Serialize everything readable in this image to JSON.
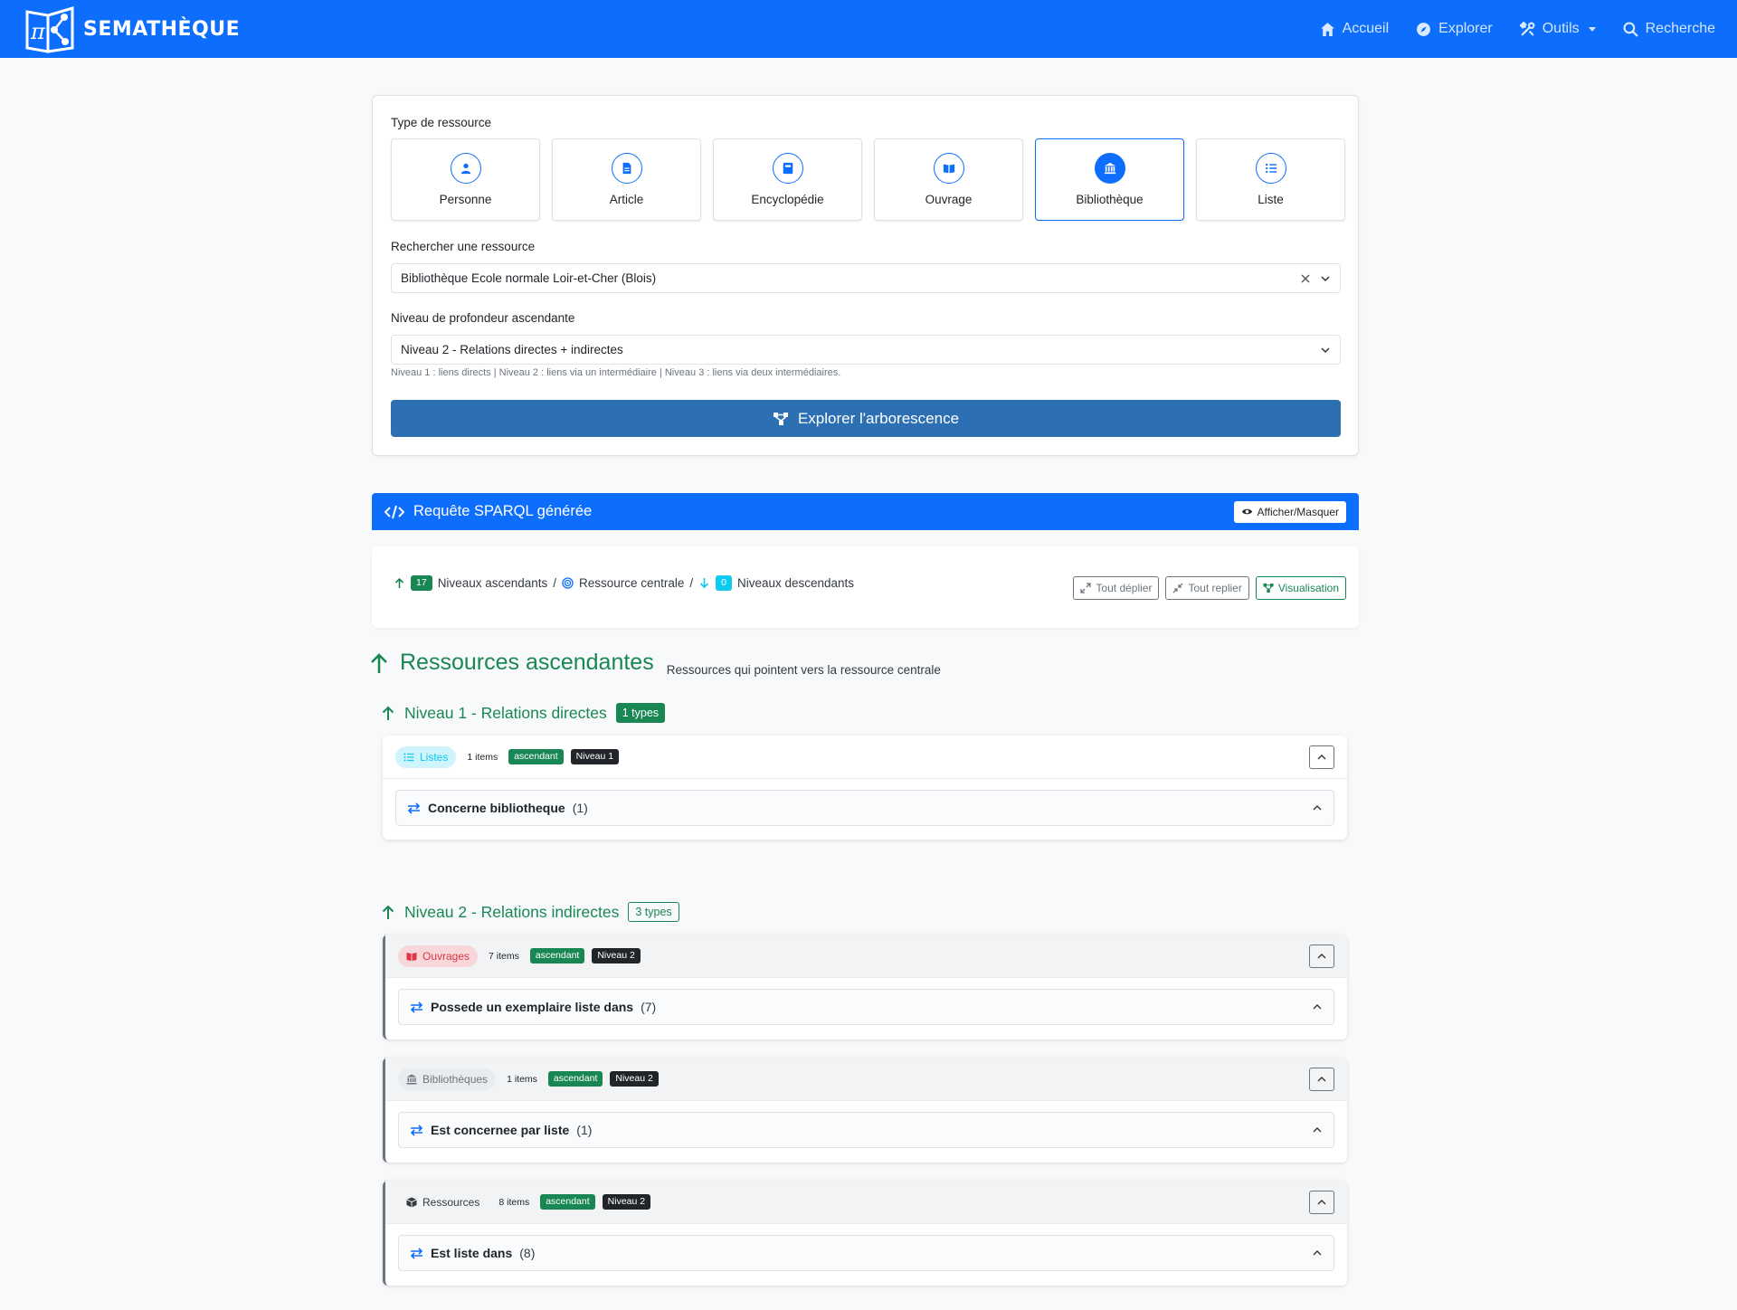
{
  "app": {
    "brand": "SEMATHÈQUE"
  },
  "nav": {
    "accueil": "Accueil",
    "explorer": "Explorer",
    "outils": "Outils",
    "recherche": "Recherche"
  },
  "form": {
    "type_label": "Type de ressource",
    "types": [
      {
        "label": "Personne",
        "icon": "person-icon",
        "active": false
      },
      {
        "label": "Article",
        "icon": "file-icon",
        "active": false
      },
      {
        "label": "Encyclopédie",
        "icon": "book-icon",
        "active": false
      },
      {
        "label": "Ouvrage",
        "icon": "open-book-icon",
        "active": false
      },
      {
        "label": "Bibliothèque",
        "icon": "library-icon",
        "active": true
      },
      {
        "label": "Liste",
        "icon": "list-icon",
        "active": false
      }
    ],
    "search_label": "Rechercher une ressource",
    "search_value": "Bibliothèque Ecole normale Loir-et-Cher (Blois)",
    "depth_label": "Niveau de profondeur ascendante",
    "depth_value": "Niveau 2 - Relations directes + indirectes",
    "depth_help": "Niveau 1 : liens directs | Niveau 2 : liens via un intermédiaire | Niveau 3 : liens via deux intermédiaires.",
    "explore_button": "Explorer l'arborescence"
  },
  "sparql": {
    "title": "Requête SPARQL générée",
    "toggle": "Afficher/Masquer"
  },
  "breadcrumb": {
    "asc_count": "17",
    "asc_label": "Niveaux ascendants",
    "sep": "/",
    "central_label": "Ressource centrale",
    "desc_count": "0",
    "desc_label": "Niveaux descendants",
    "expand_all": "Tout déplier",
    "collapse_all": "Tout replier",
    "visualisation": "Visualisation"
  },
  "ascendants": {
    "title": "Ressources ascendantes",
    "subtitle": "Ressources qui pointent vers la ressource centrale",
    "level1": {
      "title": "Niveau 1 - Relations directes",
      "badge": "1 types",
      "groups": [
        {
          "pill": "Listes",
          "items": "1 items",
          "dir": "ascendant",
          "level": "Niveau 1",
          "relation": "Concerne bibliotheque",
          "count": "(1)"
        }
      ]
    },
    "level2": {
      "title": "Niveau 2 - Relations indirectes",
      "badge": "3 types",
      "groups": [
        {
          "pill": "Ouvrages",
          "items": "7 items",
          "dir": "ascendant",
          "level": "Niveau 2",
          "relation": "Possede un exemplaire liste dans",
          "count": "(7)"
        },
        {
          "pill": "Bibliothèques",
          "items": "1 items",
          "dir": "ascendant",
          "level": "Niveau 2",
          "relation": "Est concernee par liste",
          "count": "(1)"
        },
        {
          "pill": "Ressources",
          "items": "8 items",
          "dir": "ascendant",
          "level": "Niveau 2",
          "relation": "Est liste dans",
          "count": "(8)"
        }
      ]
    }
  },
  "colors": {
    "primary": "#0d6efd",
    "success": "#198754",
    "button": "#2c6fb3"
  }
}
